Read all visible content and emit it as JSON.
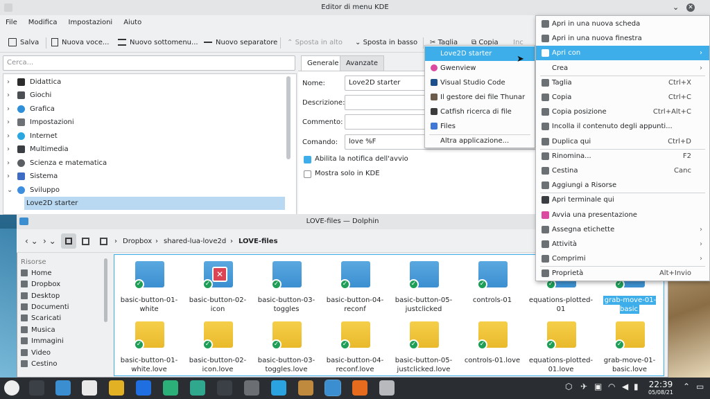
{
  "editor": {
    "title": "Editor di menu KDE",
    "menu": [
      "File",
      "Modifica",
      "Impostazioni",
      "Aiuto"
    ],
    "toolbar": {
      "save": "Salva",
      "new_item": "Nuova voce...",
      "new_submenu": "Nuovo sottomenu...",
      "new_separator": "Nuovo separatore",
      "move_up": "Sposta in alto",
      "move_down": "Sposta in basso",
      "cut": "Taglia",
      "copy": "Copia",
      "paste_cut": "Inc"
    },
    "search_placeholder": "Cerca...",
    "tree": [
      {
        "label": "Didattica",
        "color": "#2c2c2c"
      },
      {
        "label": "Giochi",
        "color": "#4b4f53"
      },
      {
        "label": "Grafica",
        "color": "#2f8fd8"
      },
      {
        "label": "Impostazioni",
        "color": "#6d7176"
      },
      {
        "label": "Internet",
        "color": "#2aa6e0"
      },
      {
        "label": "Multimedia",
        "color": "#3a3e42"
      },
      {
        "label": "Scienza e matematica",
        "color": "#5b5f63"
      },
      {
        "label": "Sistema",
        "color": "#3e6cc4"
      },
      {
        "label": "Sviluppo",
        "color": "#3e8ee0"
      },
      {
        "label": "Love2D starter",
        "color": ""
      }
    ],
    "tabs": [
      "Generale",
      "Avanzate"
    ],
    "form": {
      "name_label": "Nome:",
      "name_value": "Love2D starter",
      "desc_label": "Descrizione:",
      "comment_label": "Commento:",
      "command_label": "Comando:",
      "command_value": "love %F",
      "notify_label": "Abilita la notifica dell'avvio",
      "kde_only_label": "Mostra solo in KDE"
    }
  },
  "submenu": [
    {
      "label": "Love2D starter",
      "color": "#e0447a"
    },
    {
      "label": "Gwenview",
      "color": "#d94aa0"
    },
    {
      "label": "Visual Studio Code",
      "color": "#1d4f8c"
    },
    {
      "label": "Il gestore dei file Thunar",
      "color": "#6c5a4a"
    },
    {
      "label": "Catfish ricerca di file",
      "color": "#3b3b3b"
    },
    {
      "label": "Files",
      "color": "#3f78d6"
    },
    {
      "label": "Altra applicazione...",
      "color": ""
    }
  ],
  "context_menu": [
    {
      "label": "Apri in una nuova scheda",
      "shortcut": "",
      "sub": false,
      "color": "#6b7075"
    },
    {
      "label": "Apri in una nuova finestra",
      "shortcut": "",
      "sub": false,
      "color": "#6b7075"
    },
    {
      "label": "Apri con",
      "shortcut": "",
      "sub": true,
      "color": "#fcfcfc"
    },
    {
      "label": "Crea",
      "shortcut": "",
      "sub": true,
      "color": ""
    },
    {
      "label": "Taglia",
      "shortcut": "Ctrl+X",
      "sub": false,
      "color": "#6b7075"
    },
    {
      "label": "Copia",
      "shortcut": "Ctrl+C",
      "sub": false,
      "color": "#6b7075"
    },
    {
      "label": "Copia posizione",
      "shortcut": "Ctrl+Alt+C",
      "sub": false,
      "color": "#6b7075"
    },
    {
      "label": "Incolla il contenuto degli appunti...",
      "shortcut": "",
      "sub": false,
      "color": "#6b7075"
    },
    {
      "label": "Duplica qui",
      "shortcut": "Ctrl+D",
      "sub": false,
      "color": "#6b7075"
    },
    {
      "label": "Rinomina...",
      "shortcut": "F2",
      "sub": false,
      "color": "#6b7075"
    },
    {
      "label": "Cestina",
      "shortcut": "Canc",
      "sub": false,
      "color": "#6b7075"
    },
    {
      "label": "Aggiungi a Risorse",
      "shortcut": "",
      "sub": false,
      "color": "#6b7075"
    },
    {
      "label": "Apri terminale qui",
      "shortcut": "",
      "sub": false,
      "color": "#3a3e42"
    },
    {
      "label": "Avvia una presentazione",
      "shortcut": "",
      "sub": false,
      "color": "#d94aa0"
    },
    {
      "label": "Assegna etichette",
      "shortcut": "",
      "sub": true,
      "color": "#6b7075"
    },
    {
      "label": "Attività",
      "shortcut": "",
      "sub": true,
      "color": "#6b7075"
    },
    {
      "label": "Comprimi",
      "shortcut": "",
      "sub": true,
      "color": "#6b7075"
    },
    {
      "label": "Proprietà",
      "shortcut": "Alt+Invio",
      "sub": false,
      "color": "#6b7075"
    }
  ],
  "dolphin": {
    "title": "LOVE-files — Dolphin",
    "breadcrumb": [
      "Dropbox",
      "shared-lua-love2d",
      "LOVE-files"
    ],
    "places_title": "Risorse",
    "places": [
      "Home",
      "Dropbox",
      "Desktop",
      "Documenti",
      "Scaricati",
      "Musica",
      "Immagini",
      "Video",
      "Cestino"
    ],
    "files_row1": [
      {
        "name": "basic-button-01-white",
        "type": "folder",
        "badge": "ok"
      },
      {
        "name": "basic-button-02-icon",
        "type": "folder",
        "badge": "error"
      },
      {
        "name": "basic-button-03-toggles",
        "type": "folder",
        "badge": "ok"
      },
      {
        "name": "basic-button-04-reconf",
        "type": "folder",
        "badge": "ok"
      },
      {
        "name": "basic-button-05-justclicked",
        "type": "folder",
        "badge": "ok"
      },
      {
        "name": "controls-01",
        "type": "folder",
        "badge": "ok"
      },
      {
        "name": "equations-plotted-01",
        "type": "folder",
        "badge": "ok"
      },
      {
        "name": "grab-move-01-basic",
        "type": "folder",
        "badge": "ok"
      }
    ],
    "files_row2": [
      {
        "name": "basic-button-01-white.love",
        "type": "zip",
        "badge": "ok"
      },
      {
        "name": "basic-button-02-icon.love",
        "type": "zip",
        "badge": "ok"
      },
      {
        "name": "basic-button-03-toggles.love",
        "type": "zip",
        "badge": "ok"
      },
      {
        "name": "basic-button-04-reconf.love",
        "type": "zip",
        "badge": "ok"
      },
      {
        "name": "basic-button-05-justclicked.love",
        "type": "zip",
        "badge": "ok"
      },
      {
        "name": "controls-01.love",
        "type": "zip",
        "badge": "ok"
      },
      {
        "name": "equations-plotted-01.love",
        "type": "zip",
        "badge": "ok"
      },
      {
        "name": "grab-move-01-basic.love",
        "type": "zip",
        "badge": "ok"
      }
    ]
  },
  "taskbar": {
    "time": "22:39",
    "date": "05/08/21",
    "apps": [
      {
        "name": "application-launcher",
        "color": "#eeeeee"
      },
      {
        "name": "task-manager",
        "color": "#3b4046"
      },
      {
        "name": "store",
        "color": "#3b8fd0"
      },
      {
        "name": "document",
        "color": "#e9e9e9"
      },
      {
        "name": "chrome",
        "color": "#e3b124"
      },
      {
        "name": "dropbox",
        "color": "#1f6fe0"
      },
      {
        "name": "app-green",
        "color": "#2bb07a"
      },
      {
        "name": "app-teal",
        "color": "#2fa88e"
      },
      {
        "name": "terminal",
        "color": "#3b4046"
      },
      {
        "name": "robot",
        "color": "#6b6f73"
      },
      {
        "name": "telegram",
        "color": "#2aa3e0"
      },
      {
        "name": "paint",
        "color": "#c08a3e"
      },
      {
        "name": "dolphin",
        "color": "#3b8fd0"
      },
      {
        "name": "firefox",
        "color": "#e66b1f"
      },
      {
        "name": "menu-editor",
        "color": "#b7b9bc"
      }
    ]
  }
}
